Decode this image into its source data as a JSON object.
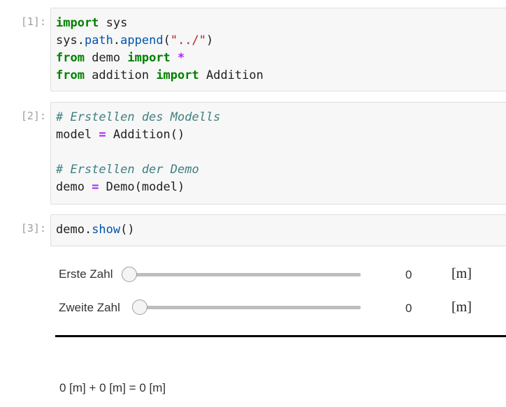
{
  "cells": [
    {
      "prompt": "[1]:",
      "lines": [
        [
          [
            "kw",
            "import"
          ],
          [
            "t",
            " sys"
          ]
        ],
        [
          [
            "t",
            "sys."
          ],
          [
            "attr",
            "path"
          ],
          [
            "t",
            "."
          ],
          [
            "attr",
            "append"
          ],
          [
            "t",
            "("
          ],
          [
            "str",
            "\"../\""
          ],
          [
            "t",
            ")"
          ]
        ],
        [
          [
            "kw",
            "from"
          ],
          [
            "t",
            " demo "
          ],
          [
            "kw",
            "import"
          ],
          [
            "t",
            " "
          ],
          [
            "op",
            "*"
          ]
        ],
        [
          [
            "kw",
            "from"
          ],
          [
            "t",
            " addition "
          ],
          [
            "kw",
            "import"
          ],
          [
            "t",
            " Addition"
          ]
        ]
      ]
    },
    {
      "prompt": "[2]:",
      "lines": [
        [
          [
            "cmt",
            "# Erstellen des Modells"
          ]
        ],
        [
          [
            "t",
            "model "
          ],
          [
            "op",
            "="
          ],
          [
            "t",
            " Addition()"
          ]
        ],
        [],
        [
          [
            "cmt",
            "# Erstellen der Demo"
          ]
        ],
        [
          [
            "t",
            "demo "
          ],
          [
            "op",
            "="
          ],
          [
            "t",
            " Demo(model)"
          ]
        ]
      ]
    },
    {
      "prompt": "[3]:",
      "lines": [
        [
          [
            "t",
            "demo."
          ],
          [
            "attr",
            "show"
          ],
          [
            "t",
            "()"
          ]
        ]
      ]
    }
  ],
  "widgets": {
    "slider1": {
      "label": "Erste Zahl",
      "value": "0",
      "unit": "[m]",
      "position": 0
    },
    "slider2": {
      "label": "Zweite Zahl",
      "value": "0",
      "unit": "[m]",
      "position": 0
    }
  },
  "result": "0 [m] + 0 [m] = 0 [m]"
}
